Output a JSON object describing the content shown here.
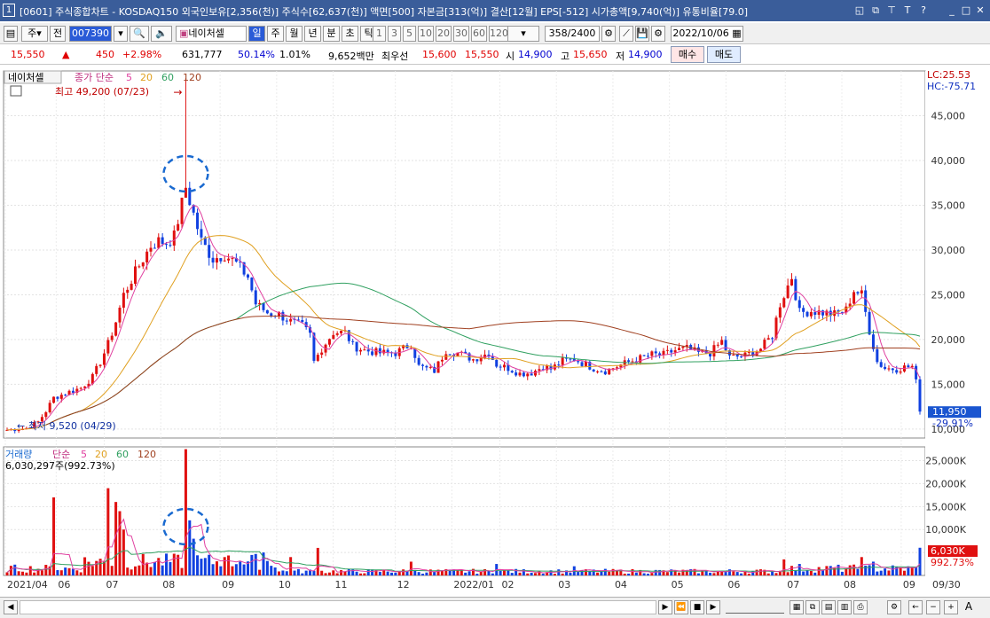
{
  "title": {
    "window_num": "1",
    "text": "[0601] 주식종합차트 - KOSDAQ150 외국인보유[2,356(천)] 주식수[62,637(천)] 액면[500] 자본금[313(억)] 결산[12월] EPS[-512] 시가총액[9,740(억)] 유통비율[79.0]",
    "icons": [
      "restore-icon",
      "copy-icon",
      "pin-icon",
      "text-icon",
      "help-icon",
      "minimize-icon",
      "maximize-icon",
      "close-icon"
    ],
    "icon_glyphs": [
      "◱",
      "⧉",
      "⊤",
      "T",
      "?",
      "_",
      "□",
      "✕"
    ]
  },
  "toolbar": {
    "market": "주",
    "prev": "전",
    "code": "007390",
    "stock_name": "네이처셀",
    "periods": [
      "일",
      "주",
      "월",
      "년",
      "분",
      "초",
      "틱"
    ],
    "intervals": [
      "1",
      "3",
      "5",
      "10",
      "20",
      "30",
      "60",
      "120"
    ],
    "count": "358",
    "total": "/2400",
    "date": "2022/10/06"
  },
  "quote": {
    "price": "15,550",
    "change": "450",
    "change_pct": "+2.98%",
    "volume": "631,777",
    "vol_ratio": "50.14%",
    "turnover": "1.01%",
    "amount": "9,652백만",
    "best_label": "최우선",
    "ask": "15,600",
    "bid": "15,550",
    "open_label": "시",
    "open": "14,900",
    "high_label": "고",
    "high": "15,650",
    "low_label": "저",
    "low": "14,900",
    "buy_label": "매수",
    "sell_label": "매도"
  },
  "chart_data": {
    "type": "candlestick",
    "x_ticks": [
      "2021/04",
      "06",
      "07",
      "08",
      "09",
      "10",
      "11",
      "12",
      "2022/01",
      "02",
      "03",
      "04",
      "05",
      "06",
      "07",
      "08",
      "09",
      "09/30"
    ],
    "price_axis": [
      "45,000",
      "40,000",
      "35,000",
      "30,000",
      "25,000",
      "20,000",
      "15,000",
      "10,000"
    ],
    "price_range": [
      9000,
      50000
    ],
    "volume_axis": [
      "25,000K",
      "20,000K",
      "15,000K",
      "10,000K",
      "5,000K"
    ],
    "volume_range": [
      0,
      28000000
    ],
    "main_legend": {
      "stock": "네이처셀",
      "type": "종가 단순",
      "ma": [
        "5",
        "20",
        "60",
        "120"
      ]
    },
    "volume_legend": {
      "label": "거래량",
      "type": "단순",
      "ma": [
        "5",
        "20",
        "60",
        "120"
      ]
    },
    "volume_info": "6,030,297주(992.73%)",
    "max_label": "최고 49,200 (07/23)",
    "min_label": "최저 9,520 (04/29)",
    "lc": "LC:25.53",
    "hc": "HC:-75.71",
    "last_price": "11,950",
    "last_pct": "-29.91%",
    "last_vol": "6,030K",
    "last_vol_pct": "992.73%",
    "close_anchors": [
      [
        0,
        9900
      ],
      [
        5,
        10100
      ],
      [
        8,
        10800
      ],
      [
        10,
        12000
      ],
      [
        12,
        13500
      ],
      [
        15,
        14000
      ],
      [
        19,
        14600
      ],
      [
        22,
        15800
      ],
      [
        24,
        17500
      ],
      [
        26,
        19500
      ],
      [
        28,
        22000
      ],
      [
        30,
        25000
      ],
      [
        33,
        27500
      ],
      [
        35,
        29000
      ],
      [
        37,
        30500
      ],
      [
        39,
        31000
      ],
      [
        41,
        30800
      ],
      [
        43,
        31500
      ],
      [
        46,
        37000
      ],
      [
        48,
        34000
      ],
      [
        50,
        31000
      ],
      [
        53,
        29000
      ],
      [
        56,
        29500
      ],
      [
        59,
        28500
      ],
      [
        62,
        27000
      ],
      [
        64,
        24000
      ],
      [
        67,
        23000
      ],
      [
        70,
        22800
      ],
      [
        73,
        22000
      ],
      [
        76,
        21500
      ],
      [
        78,
        20500
      ],
      [
        79,
        17500
      ],
      [
        81,
        19000
      ],
      [
        84,
        20800
      ],
      [
        87,
        20800
      ],
      [
        89,
        19300
      ],
      [
        92,
        18800
      ],
      [
        96,
        18500
      ],
      [
        100,
        18500
      ],
      [
        104,
        19500
      ],
      [
        106,
        17000
      ],
      [
        110,
        16500
      ],
      [
        113,
        18800
      ],
      [
        116,
        18500
      ],
      [
        120,
        17800
      ],
      [
        124,
        18500
      ],
      [
        126,
        17200
      ],
      [
        129,
        16800
      ],
      [
        132,
        16200
      ],
      [
        135,
        16300
      ],
      [
        138,
        17000
      ],
      [
        140,
        16700
      ],
      [
        143,
        17600
      ],
      [
        146,
        17800
      ],
      [
        149,
        17200
      ],
      [
        151,
        16800
      ],
      [
        154,
        16500
      ],
      [
        157,
        17000
      ],
      [
        160,
        17500
      ],
      [
        163,
        17900
      ],
      [
        166,
        18300
      ],
      [
        169,
        18300
      ],
      [
        172,
        18800
      ],
      [
        175,
        19000
      ],
      [
        178,
        18500
      ],
      [
        181,
        18500
      ],
      [
        184,
        19800
      ],
      [
        186,
        18000
      ],
      [
        190,
        18200
      ],
      [
        194,
        19000
      ],
      [
        197,
        20500
      ],
      [
        199,
        24000
      ],
      [
        202,
        27000
      ],
      [
        204,
        23000
      ],
      [
        207,
        23200
      ],
      [
        210,
        23000
      ],
      [
        213,
        22800
      ],
      [
        216,
        23300
      ],
      [
        218,
        25500
      ],
      [
        220,
        25000
      ],
      [
        222,
        21000
      ],
      [
        224,
        17500
      ],
      [
        226,
        16800
      ],
      [
        229,
        16700
      ],
      [
        231,
        16900
      ],
      [
        233,
        17000
      ],
      [
        234,
        15550
      ],
      [
        235,
        11950
      ]
    ],
    "vol_spikes": [
      [
        12,
        17000000
      ],
      [
        26,
        19000000
      ],
      [
        28,
        16000000
      ],
      [
        29,
        14000000
      ],
      [
        30,
        10000000
      ],
      [
        46,
        27500000
      ],
      [
        47,
        12000000
      ],
      [
        48,
        8000000
      ],
      [
        56,
        4000000
      ],
      [
        60,
        3000000
      ],
      [
        66,
        5000000
      ],
      [
        73,
        4000000
      ],
      [
        80,
        6000000
      ],
      [
        104,
        3000000
      ],
      [
        126,
        2500000
      ],
      [
        146,
        2000000
      ],
      [
        200,
        3500000
      ],
      [
        204,
        2500000
      ],
      [
        220,
        4000000
      ],
      [
        223,
        3000000
      ],
      [
        235,
        6030297
      ]
    ]
  },
  "bottom": {
    "buttons": [
      "◀",
      "▶",
      "⏮",
      "■",
      "▶"
    ],
    "zoom": [
      "−",
      "+",
      "A"
    ]
  }
}
